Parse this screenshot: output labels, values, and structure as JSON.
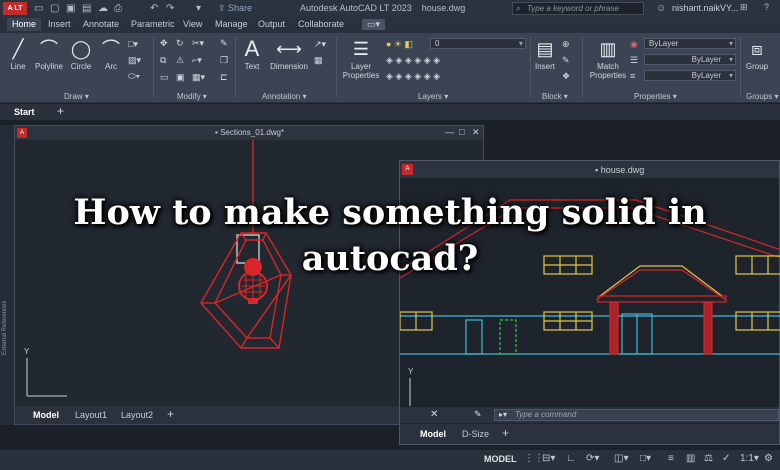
{
  "titlebar": {
    "app_badge": "A LT",
    "share": "Share",
    "app_title": "Autodesk AutoCAD LT 2023",
    "file": "house.dwg",
    "search_placeholder": "Type a keyword or phrase",
    "user": "nishant.naikVY..."
  },
  "tabs": [
    "Home",
    "Insert",
    "Annotate",
    "Parametric",
    "View",
    "Manage",
    "Output",
    "Collaborate"
  ],
  "ribbon": {
    "draw": {
      "title": "Draw",
      "buttons": [
        "Line",
        "Polyline",
        "Circle",
        "Arc"
      ]
    },
    "modify": {
      "title": "Modify"
    },
    "annotation": {
      "title": "Annotation",
      "buttons": [
        "Text",
        "Dimension"
      ]
    },
    "layers": {
      "title": "Layers",
      "layer_properties": "Layer Properties",
      "current_layer": "0"
    },
    "block": {
      "title": "Block",
      "insert": "Insert"
    },
    "properties": {
      "title": "Properties",
      "match": "Match Properties",
      "color": "ByLayer",
      "linetype": "ByLayer",
      "lineweight": "ByLayer"
    },
    "groups": {
      "title": "Groups",
      "group": "Group"
    }
  },
  "file_tabs": {
    "start": "Start"
  },
  "sidebar": {
    "external_references": "External References"
  },
  "window_left": {
    "title": "Sections_01.dwg*",
    "tabs": [
      "Model",
      "Layout1",
      "Layout2"
    ],
    "axis_y": "Y"
  },
  "window_right": {
    "title": "house.dwg",
    "command_placeholder": "Type a command",
    "tabs": [
      "Model",
      "D-Size"
    ],
    "axis_y": "Y"
  },
  "status": {
    "model": "MODEL",
    "scale": "1:1"
  },
  "headline": {
    "line1": "How to make something solid in",
    "line2": "autocad?"
  },
  "colors": {
    "accent_red": "#c42b2b",
    "wire_red": "#e23a3a",
    "cad_yellow": "#e0c64a",
    "cad_cyan": "#43b8d8",
    "cad_green": "#3fbf4a"
  }
}
